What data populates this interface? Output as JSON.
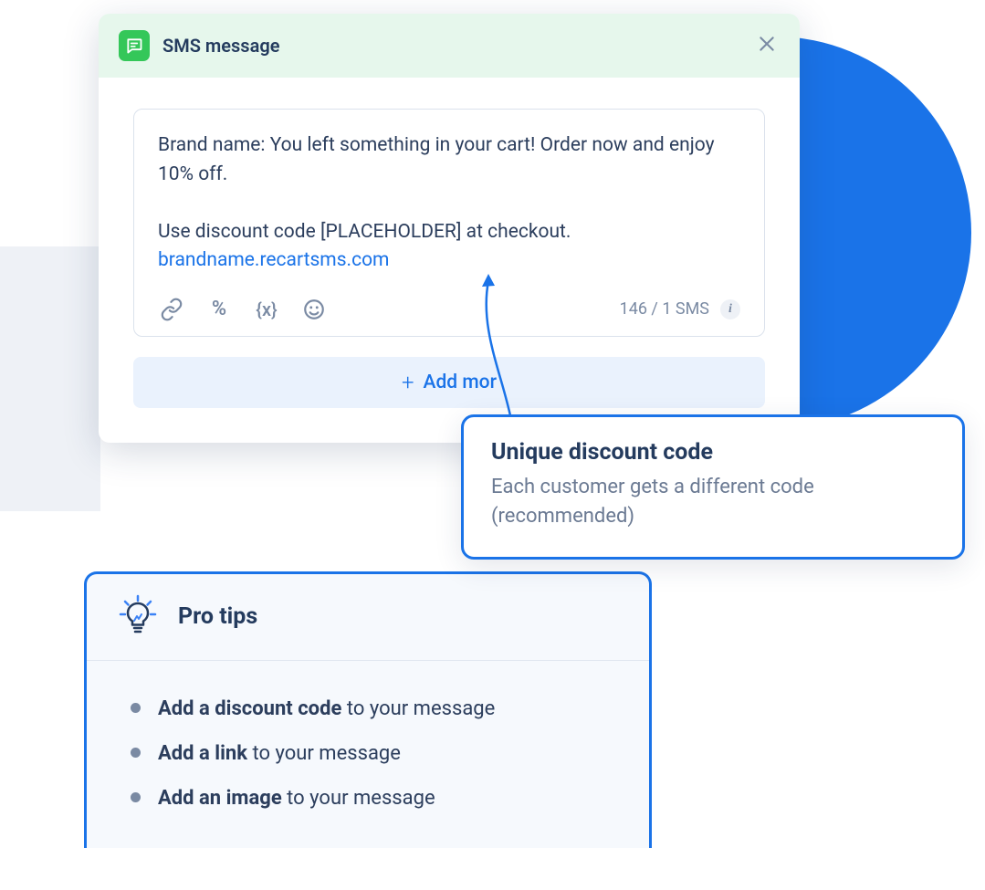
{
  "sms": {
    "header_title": "SMS message",
    "message_line1": "Brand name: You left something in your cart! Order now and enjoy 10% off.",
    "message_line2": "Use discount code [PLACEHOLDER] at checkout.",
    "link": "brandname.recartsms.com",
    "counter": "146 / 1 SMS",
    "add_more": "Add mor"
  },
  "callout": {
    "title": "Unique discount code",
    "desc": "Each customer gets a different code (recommended)"
  },
  "protips": {
    "title": "Pro tips",
    "items": [
      {
        "bold": "Add a discount code",
        "rest": " to your message"
      },
      {
        "bold": "Add a link",
        "rest": " to your message"
      },
      {
        "bold": "Add an image",
        "rest": " to your message"
      }
    ]
  }
}
